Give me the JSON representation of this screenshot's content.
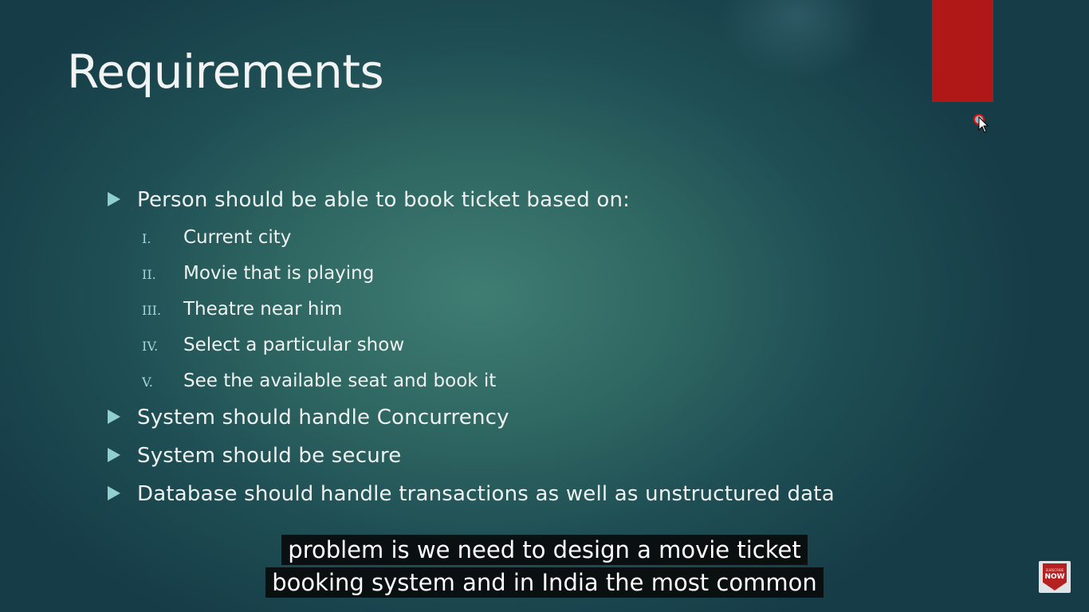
{
  "slide": {
    "title": "Requirements",
    "bullets": [
      {
        "text": "Person should be able to book ticket based on:",
        "subitems": [
          {
            "num": "I.",
            "text": "Current city"
          },
          {
            "num": "II.",
            "text": "Movie that is playing"
          },
          {
            "num": "III.",
            "text": "Theatre near him"
          },
          {
            "num": "IV.",
            "text": "Select a particular show"
          },
          {
            "num": "V.",
            "text": "See the available seat and book it"
          }
        ]
      },
      {
        "text": "System should handle Concurrency"
      },
      {
        "text": "System should be secure"
      },
      {
        "text": "Database should handle transactions as well as unstructured data"
      }
    ]
  },
  "captions": {
    "line1": "problem is we need to design a movie ticket",
    "line2": "booking system and in India the most common"
  },
  "badge": {
    "top": "SUBSCRIBE",
    "bottom": "NOW"
  },
  "colors": {
    "background": "#2f6762",
    "accent_bar": "#b01717",
    "bullet_marker": "#8fd0cf",
    "caption_bg": "#080808"
  },
  "icons": {
    "bullet": "triangle-bullet-icon",
    "cursor": "mouse-pointer-icon",
    "badge": "subscribe-badge-icon"
  }
}
